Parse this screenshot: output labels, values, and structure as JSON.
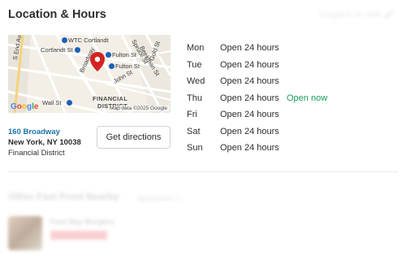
{
  "section": {
    "title": "Location & Hours",
    "suggest_label": "Suggest an edit"
  },
  "map": {
    "labels": {
      "wtc": "WTC Cortlandt",
      "cortlandt": "Cortlandt St",
      "fulton1": "Fulton St",
      "fulton2": "Fulton St",
      "fulton3": "Fulton St",
      "spruce": "Spruce St",
      "beekman": "Beekman St",
      "gold": "Gold St",
      "john": "John St",
      "broadway": "Broadway",
      "eastend": "S End Ave",
      "wall": "Wall St",
      "financial1": "FINANCIAL",
      "financial2": "DISTRICT"
    },
    "google": "Google",
    "attribution": "Map data ©2025 Google"
  },
  "address": {
    "street": "160 Broadway",
    "city": "New York, NY 10038",
    "neighborhood": "Financial District"
  },
  "directions_label": "Get directions",
  "hours": [
    {
      "day": "Mon",
      "hours": "Open 24 hours",
      "status": ""
    },
    {
      "day": "Tue",
      "hours": "Open 24 hours",
      "status": ""
    },
    {
      "day": "Wed",
      "hours": "Open 24 hours",
      "status": ""
    },
    {
      "day": "Thu",
      "hours": "Open 24 hours",
      "status": "Open now"
    },
    {
      "day": "Fri",
      "hours": "Open 24 hours",
      "status": ""
    },
    {
      "day": "Sat",
      "hours": "Open 24 hours",
      "status": ""
    },
    {
      "day": "Sun",
      "hours": "Open 24 hours",
      "status": ""
    }
  ],
  "colors": {
    "link": "#1a72a8",
    "open_now": "#1a9a5c",
    "pin": "#d32323"
  },
  "nearby": {
    "title": "Other Fast Food Nearby",
    "sponsored": "Sponsored ⓘ",
    "business_name": "Fast Bay Burgers",
    "tag_text": "",
    "rating_text": "",
    "description": ""
  }
}
